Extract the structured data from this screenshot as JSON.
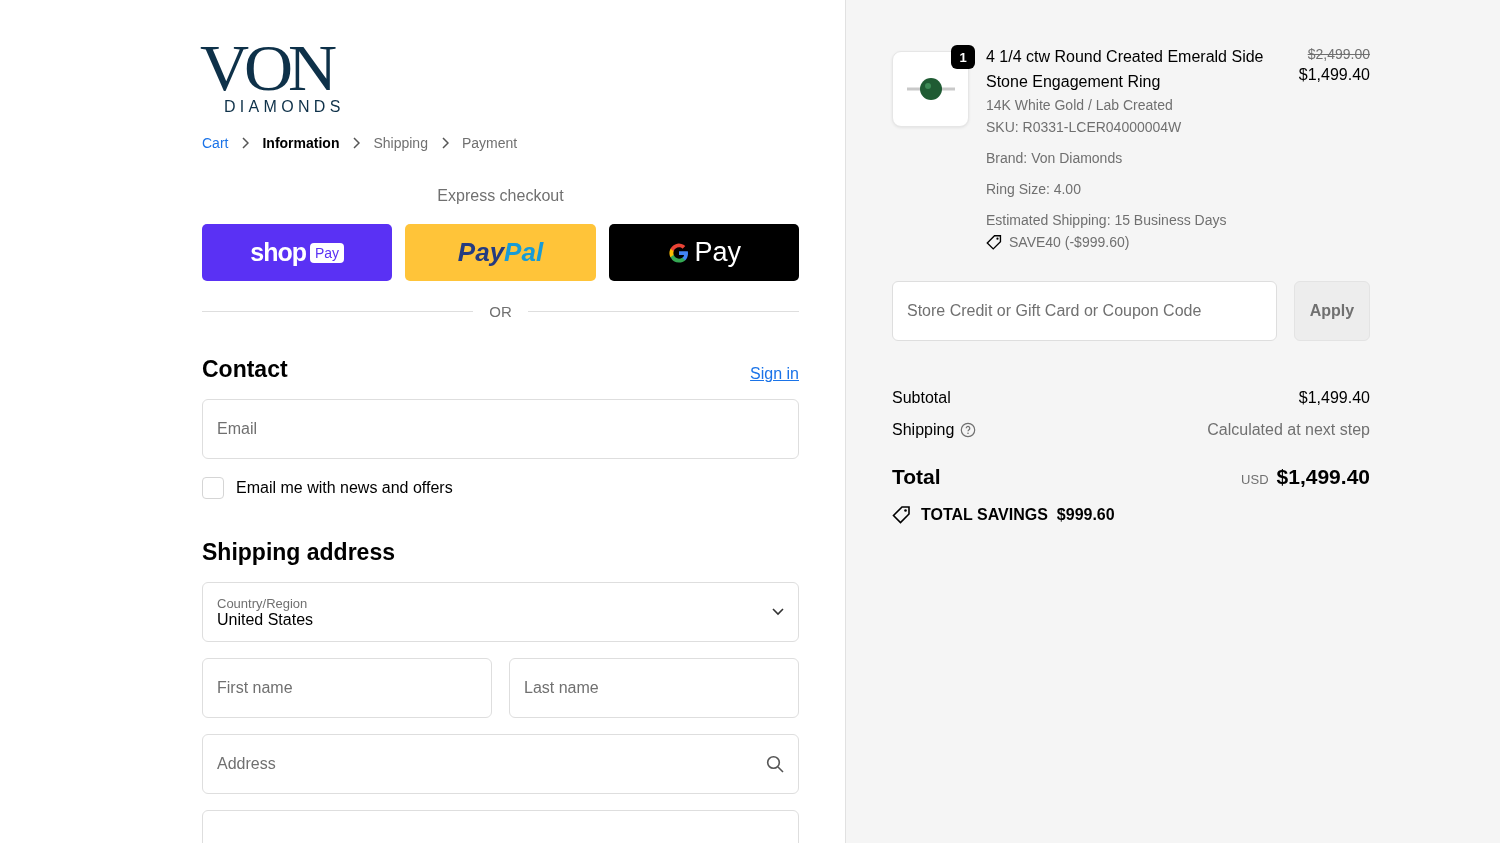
{
  "logo": {
    "wordmark": "VON",
    "tagline": "DIAMONDS"
  },
  "breadcrumbs": [
    {
      "label": "Cart",
      "kind": "link"
    },
    {
      "label": "Information",
      "kind": "current"
    },
    {
      "label": "Shipping",
      "kind": "upcoming"
    },
    {
      "label": "Payment",
      "kind": "upcoming"
    }
  ],
  "express_checkout": {
    "title": "Express checkout",
    "buttons": [
      {
        "kind": "shop_pay",
        "parts": [
          "shop",
          "Pay"
        ]
      },
      {
        "kind": "paypal",
        "parts": [
          "Pay",
          "Pal"
        ]
      },
      {
        "kind": "google_pay",
        "parts": [
          "Pay"
        ]
      }
    ],
    "divider": "OR"
  },
  "contact": {
    "title": "Contact",
    "sign_in": "Sign in",
    "email": {
      "placeholder": "Email"
    },
    "newsletter": {
      "label": "Email me with news and offers",
      "checked": false
    }
  },
  "shipping_address": {
    "title": "Shipping address",
    "country": {
      "label": "Country/Region",
      "value": "United States"
    },
    "first_name": {
      "placeholder": "First name"
    },
    "last_name": {
      "placeholder": "Last name"
    },
    "address": {
      "placeholder": "Address"
    }
  },
  "summary": {
    "item": {
      "quantity": "1",
      "title": "4 1/4 ctw Round Created Emerald Side Stone Engagement Ring",
      "compare_price": "$2,499.00",
      "price": "$1,499.40",
      "variant": "14K White Gold / Lab Created",
      "sku": "SKU: R0331-LCER04000004W",
      "properties": [
        "Brand: Von Diamonds",
        "Ring Size: 4.00",
        "Estimated Shipping: 15 Business Days"
      ],
      "discount": "SAVE40 (-$999.60)"
    },
    "coupon": {
      "placeholder": "Store Credit or Gift Card or Coupon Code",
      "button": "Apply",
      "disabled": true
    },
    "subtotal": {
      "label": "Subtotal",
      "value": "$1,499.40"
    },
    "shipping": {
      "label": "Shipping",
      "value": "Calculated at next step"
    },
    "total": {
      "label": "Total",
      "currency": "USD",
      "value": "$1,499.40"
    },
    "savings": {
      "label": "TOTAL SAVINGS",
      "value": "$999.60"
    }
  }
}
